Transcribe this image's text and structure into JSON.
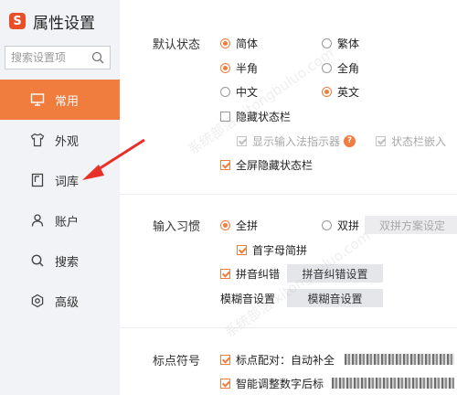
{
  "app": {
    "title": "属性设置",
    "logo_letter": "S"
  },
  "search": {
    "placeholder": "搜索设置项"
  },
  "sidebar": {
    "items": [
      {
        "label": "常用",
        "icon": "monitor-icon",
        "active": true
      },
      {
        "label": "外观",
        "icon": "shirt-icon"
      },
      {
        "label": "词库",
        "icon": "book-icon"
      },
      {
        "label": "账户",
        "icon": "user-icon"
      },
      {
        "label": "搜索",
        "icon": "search-icon"
      },
      {
        "label": "高级",
        "icon": "gear-icon"
      }
    ]
  },
  "default_state": {
    "label": "默认状态",
    "simplified": "简体",
    "traditional": "繁体",
    "halfwidth": "半角",
    "fullwidth": "全角",
    "chinese": "中文",
    "english": "英文",
    "hide_status_bar": "隐藏状态栏",
    "show_indicator": "显示输入法指示器",
    "status_bar_embed": "状态栏嵌入",
    "fullscreen_hide": "全屏隐藏状态栏"
  },
  "input_habit": {
    "label": "输入习惯",
    "quanpin": "全拼",
    "shuangpin": "双拼",
    "shuangpin_settings": "双拼方案设定",
    "initial_abbrev": "首字母简拼",
    "pinyin_correction": "拼音纠错",
    "pinyin_correction_settings": "拼音纠错设置",
    "fuzzy_label": "模糊音设置",
    "fuzzy_button": "模糊音设置"
  },
  "punctuation": {
    "label": "标点符号",
    "pairing": "标点配对：自动补全",
    "smart_digit": "智能调整数字后标"
  },
  "colors": {
    "accent": "#f07c3e",
    "sidebar_bg": "#f2f3f6",
    "arrow": "#e8302a"
  }
}
